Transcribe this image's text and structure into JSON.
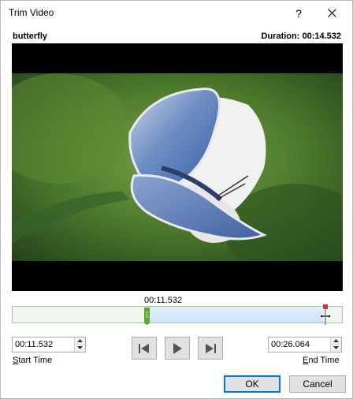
{
  "window": {
    "title": "Trim Video",
    "help_label": "?"
  },
  "video": {
    "name": "butterfly",
    "duration": "Duration: 00:14.532"
  },
  "timeline": {
    "current_time": "00:11.532"
  },
  "start": {
    "value": "00:11.532",
    "label_underlined": "S",
    "label_rest": "tart Time"
  },
  "end": {
    "value": "00:26.064",
    "label_underlined": "E",
    "label_rest": "nd Time"
  },
  "buttons": {
    "ok": "OK",
    "cancel": "Cancel"
  },
  "icons": {
    "close": "close-icon",
    "help": "help-icon",
    "previous_frame": "previous-frame-icon",
    "play": "play-icon",
    "next_frame": "next-frame-icon",
    "spin_up": "spin-up-icon",
    "spin_down": "spin-down-icon",
    "start_handle": "start-trim-handle-icon",
    "end_handle": "end-trim-handle-icon",
    "resize_cursor": "resize-horizontal-cursor-icon"
  },
  "colors": {
    "start_handle": "#5fa830",
    "end_handle": "#d13438",
    "selection": "#cfe2fb",
    "ok_border": "#0078d7"
  }
}
